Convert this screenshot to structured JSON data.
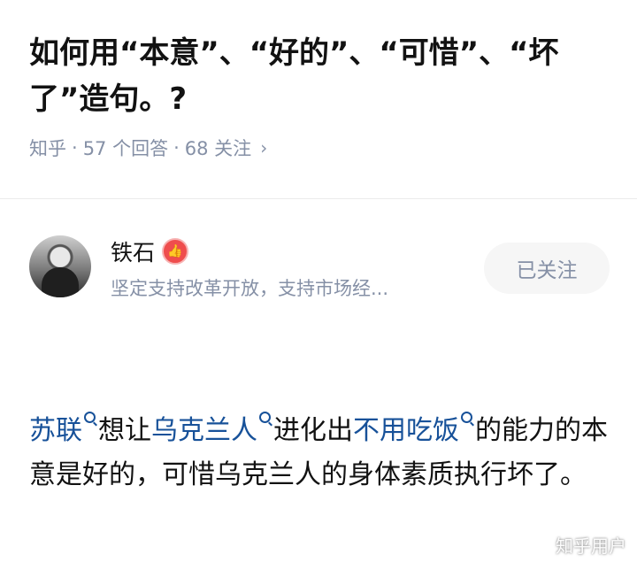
{
  "question": {
    "title": "如何用“本意”、“好的”、“可惜”、“坏了”造句。?",
    "source": "知乎",
    "answers_count": "57 个回答",
    "followers_count": "68 关注"
  },
  "author": {
    "name": "铁石",
    "bio": "坚定支持改革开放，支持市场经...",
    "follow_button": "已关注"
  },
  "answer": {
    "link_1": "苏联",
    "text_1": "想让",
    "link_2": "乌克兰人",
    "text_2": "进化出",
    "link_3": "不用吃饭",
    "text_3": "的能力的本意是好的，可惜乌克兰人的身体素质执行坏了。"
  },
  "watermark": "知乎用户"
}
